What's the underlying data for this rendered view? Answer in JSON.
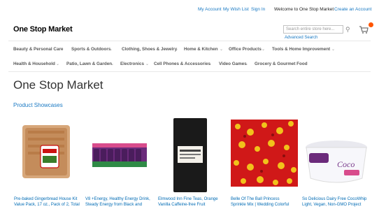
{
  "header": {
    "my_account": "My Account",
    "wishlist": "My Wish List",
    "sign_in": "Sign In",
    "welcome": "Welcome to One Stop Market",
    "create_account": "Create an Account"
  },
  "logo": {
    "text": "One Stop Market"
  },
  "search": {
    "placeholder": "Search entire store here...",
    "advanced": "Advanced Search"
  },
  "nav": {
    "row1": [
      "Beauty & Personal Care",
      "Sports & Outdoors",
      "Clothing, Shoes & Jewelry",
      "Home & Kitchen",
      "Office Products",
      "Tools & Home Improvement"
    ],
    "row2": [
      "Health & Household",
      "Patio, Lawn & Garden",
      "Electronics",
      "Cell Phones & Accessories",
      "Video Games",
      "Grocery & Gourmet Food"
    ]
  },
  "page": {
    "title": "One Stop Market",
    "section": "Product Showcases"
  },
  "products": [
    {
      "name_line1": "Pre-baked Gingerbread House Kit",
      "name_line2": "Value Pack, 17 oz., Pack of 2, Total"
    },
    {
      "name_line1": "V8 +Energy, Healthy Energy Drink,",
      "name_line2": "Steady Energy from Black and"
    },
    {
      "name_line1": "Elmwood Inn Fine Teas, Orange",
      "name_line2": "Vanilla Caffeine-free Fruit"
    },
    {
      "name_line1": "Belle Of The Ball Princess",
      "name_line2": "Sprinkle Mix | Wedding Colorful"
    },
    {
      "name_line1": "So Delicious Dairy Free CocoWhip",
      "name_line2": "Light, Vegan, Non-GMO Project"
    }
  ],
  "colors": {
    "link": "#1979c3",
    "accent": "#ff5501"
  }
}
